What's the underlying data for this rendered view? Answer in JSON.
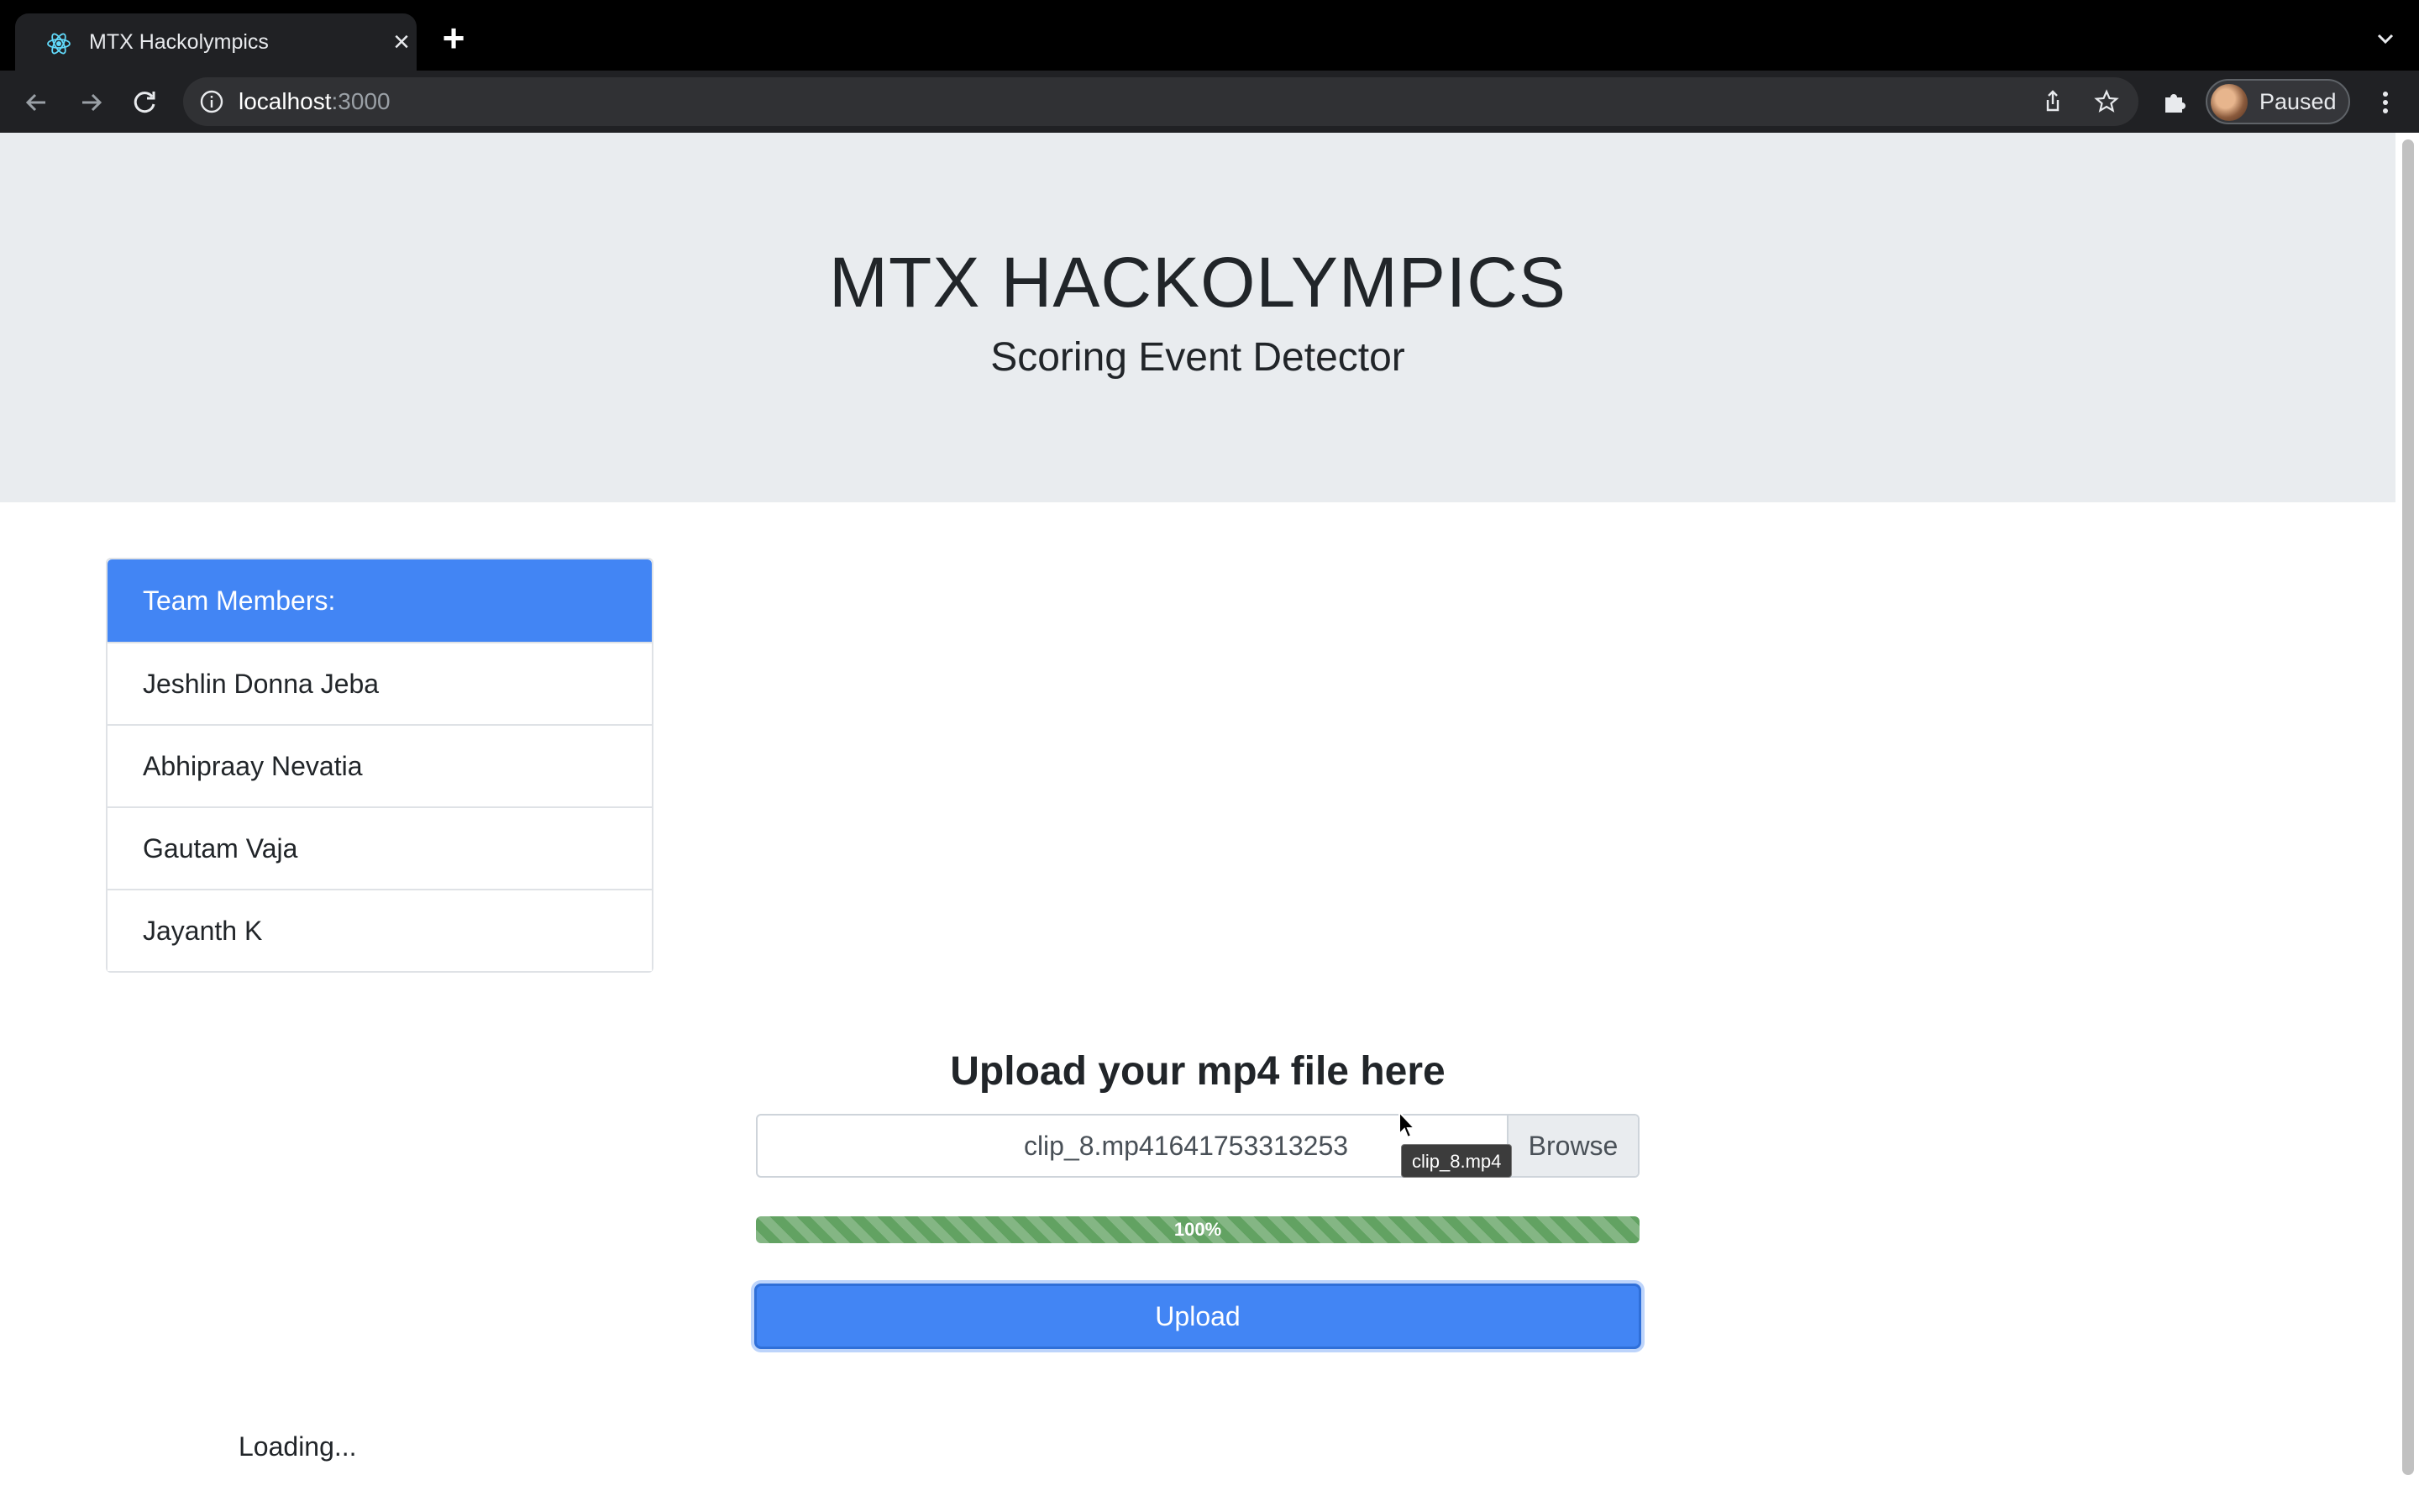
{
  "browser": {
    "tab_title": "MTX Hackolympics",
    "url_host": "localhost",
    "url_port": ":3000",
    "profile_label": "Paused"
  },
  "header": {
    "title": "MTX HACKOLYMPICS",
    "subtitle": "Scoring Event Detector"
  },
  "team": {
    "header": "Team Members:",
    "members": [
      "Jeshlin Donna Jeba",
      "Abhipraay Nevatia",
      "Gautam Vaja",
      "Jayanth K"
    ]
  },
  "upload": {
    "heading": "Upload your mp4 file here",
    "file_name": "clip_8.mp41641753313253",
    "browse_label": "Browse",
    "tooltip": "clip_8.mp4",
    "progress": 1.0,
    "progress_label": "100%",
    "button_label": "Upload"
  },
  "status": {
    "loading": "Loading..."
  },
  "colors": {
    "primary": "#4285f4",
    "progress": "#62a262",
    "jumbotron": "#e9ecef"
  }
}
